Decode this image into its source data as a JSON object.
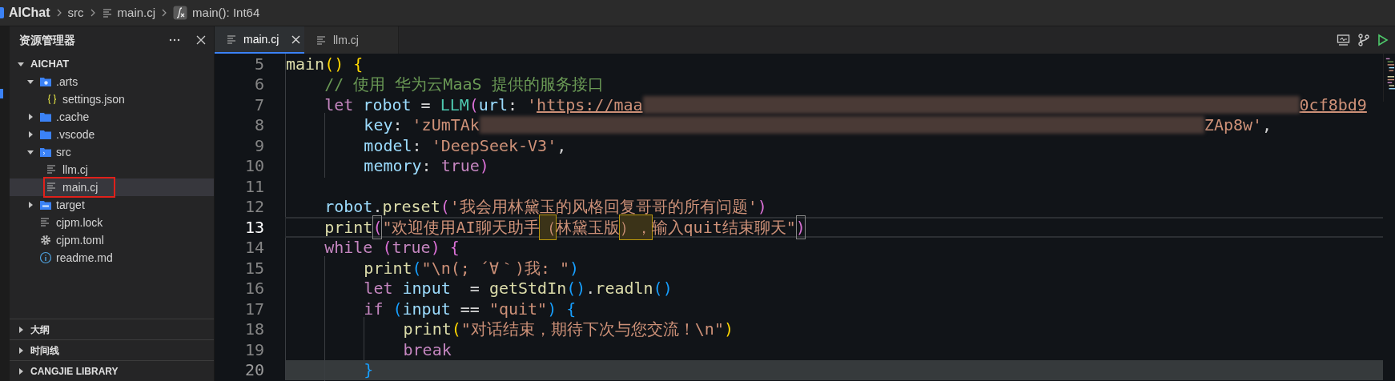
{
  "breadcrumb": [
    {
      "text": "AIChat",
      "kind": "folder"
    },
    {
      "text": "src",
      "kind": "folder"
    },
    {
      "text": "main.cj",
      "kind": "file"
    },
    {
      "text": "main(): Int64",
      "kind": "function"
    }
  ],
  "explorer": {
    "title": "资源管理器",
    "root": {
      "label": "AICHAT",
      "expanded": true,
      "children": [
        {
          "label": ".arts",
          "kind": "configfolder",
          "expanded": true,
          "selected": false,
          "children": [
            {
              "label": "settings.json",
              "kind": "json",
              "selected": false
            }
          ]
        },
        {
          "label": ".cache",
          "kind": "folder",
          "expanded": false,
          "selected": false
        },
        {
          "label": ".vscode",
          "kind": "folder",
          "expanded": false,
          "selected": false
        },
        {
          "label": "src",
          "kind": "sourcefolder",
          "expanded": true,
          "selected": false,
          "children": [
            {
              "label": "llm.cj",
              "kind": "text",
              "selected": false
            },
            {
              "label": "main.cj",
              "kind": "text",
              "selected": true,
              "annotated": true
            }
          ]
        },
        {
          "label": "target",
          "kind": "buildfolder",
          "expanded": false,
          "selected": false
        },
        {
          "label": "cjpm.lock",
          "kind": "text",
          "selected": false
        },
        {
          "label": "cjpm.toml",
          "kind": "config",
          "selected": false
        },
        {
          "label": "readme.md",
          "kind": "info",
          "selected": false
        }
      ]
    },
    "panels": [
      {
        "label": "大纲",
        "expanded": false
      },
      {
        "label": "时间线",
        "expanded": false
      },
      {
        "label": "CANGJIE LIBRARY",
        "expanded": false
      }
    ]
  },
  "tabs": [
    {
      "label": "main.cj",
      "selected": true
    },
    {
      "label": "llm.cj",
      "selected": false
    }
  ],
  "editor": {
    "lines": [
      {
        "number": "5",
        "current": false,
        "highlighted": false,
        "tokens": [
          {
            "text": "main",
            "kind": "fn"
          },
          {
            "text": "() {",
            "kind": "b1"
          }
        ]
      },
      {
        "number": "6",
        "current": false,
        "highlighted": false,
        "tokens": [
          {
            "text": "    // 使用 华为云MaaS 提供的服务接口",
            "kind": "cmt"
          }
        ]
      },
      {
        "number": "7",
        "current": false,
        "highlighted": false,
        "tokens": [
          {
            "text": "    let",
            "kind": "kw"
          },
          {
            "text": " robot",
            "kind": "var"
          },
          {
            "text": " = ",
            "kind": "plain"
          },
          {
            "text": "LLM",
            "kind": "type"
          },
          {
            "text": "(",
            "kind": "b2"
          },
          {
            "text": "url",
            "kind": "var"
          },
          {
            "text": ": ",
            "kind": "plain"
          },
          {
            "text": "'",
            "kind": "str"
          },
          {
            "text": "https://maa",
            "kind": "link"
          },
          {
            "kind": "redacted"
          },
          {
            "text": "0cf8bd9",
            "kind": "link"
          }
        ]
      },
      {
        "number": "8",
        "current": false,
        "highlighted": false,
        "tokens": [
          {
            "text": "        key",
            "kind": "var"
          },
          {
            "text": ": ",
            "kind": "plain"
          },
          {
            "text": "'zUmTAk",
            "kind": "str"
          },
          {
            "kind": "redacted"
          },
          {
            "text": "ZAp8w'",
            "kind": "str"
          },
          {
            "text": ",",
            "kind": "plain"
          }
        ]
      },
      {
        "number": "9",
        "current": false,
        "highlighted": false,
        "tokens": [
          {
            "text": "        model",
            "kind": "var"
          },
          {
            "text": ": ",
            "kind": "plain"
          },
          {
            "text": "'DeepSeek-V3'",
            "kind": "str"
          },
          {
            "text": ",",
            "kind": "plain"
          }
        ]
      },
      {
        "number": "10",
        "current": false,
        "highlighted": false,
        "tokens": [
          {
            "text": "        memory",
            "kind": "var"
          },
          {
            "text": ": ",
            "kind": "plain"
          },
          {
            "text": "true",
            "kind": "kw"
          },
          {
            "text": ")",
            "kind": "b2"
          }
        ]
      },
      {
        "number": "11",
        "current": false,
        "highlighted": false
      },
      {
        "number": "12",
        "current": false,
        "highlighted": false,
        "tokens": [
          {
            "text": "    robot",
            "kind": "var"
          },
          {
            "text": ".",
            "kind": "plain"
          },
          {
            "text": "preset",
            "kind": "fn"
          },
          {
            "text": "(",
            "kind": "b2"
          },
          {
            "text": "'我会用林黛玉的风格回复哥哥的所有问题'",
            "kind": "str"
          },
          {
            "text": ")",
            "kind": "b2"
          }
        ]
      },
      {
        "number": "13",
        "current": true,
        "highlighted": false,
        "tokens": [
          {
            "text": "    print",
            "kind": "fn"
          },
          {
            "text": "(",
            "kind": "match"
          },
          {
            "text": "\"欢迎使用AI聊天助手",
            "kind": "str"
          },
          {
            "text": "（",
            "kind": "flagged"
          },
          {
            "text": "林黛玉版",
            "kind": "str"
          },
          {
            "text": "），",
            "kind": "flagged"
          },
          {
            "text": "输入quit结束聊天\"",
            "kind": "str"
          },
          {
            "text": ")",
            "kind": "match"
          }
        ]
      },
      {
        "number": "14",
        "current": false,
        "highlighted": false,
        "tokens": [
          {
            "text": "    while ",
            "kind": "kw"
          },
          {
            "text": "(",
            "kind": "b2"
          },
          {
            "text": "true",
            "kind": "kw"
          },
          {
            "text": ") {",
            "kind": "b2"
          }
        ]
      },
      {
        "number": "15",
        "current": false,
        "highlighted": false,
        "tokens": [
          {
            "text": "        print",
            "kind": "fn"
          },
          {
            "text": "(",
            "kind": "b3"
          },
          {
            "text": "\"\\n(; ´∀｀)我: \"",
            "kind": "str"
          },
          {
            "text": ")",
            "kind": "b3"
          }
        ]
      },
      {
        "number": "16",
        "current": false,
        "highlighted": false,
        "tokens": [
          {
            "text": "        let",
            "kind": "kw"
          },
          {
            "text": " input",
            "kind": "var"
          },
          {
            "text": "  = ",
            "kind": "plain"
          },
          {
            "text": "getStdIn",
            "kind": "fn"
          },
          {
            "text": "()",
            "kind": "b3"
          },
          {
            "text": ".",
            "kind": "plain"
          },
          {
            "text": "readln",
            "kind": "fn"
          },
          {
            "text": "()",
            "kind": "b3"
          }
        ]
      },
      {
        "number": "17",
        "current": false,
        "highlighted": false,
        "tokens": [
          {
            "text": "        if ",
            "kind": "kw"
          },
          {
            "text": "(",
            "kind": "b3"
          },
          {
            "text": "input",
            "kind": "var"
          },
          {
            "text": " == ",
            "kind": "plain"
          },
          {
            "text": "\"quit\"",
            "kind": "str"
          },
          {
            "text": ") {",
            "kind": "b3"
          }
        ]
      },
      {
        "number": "18",
        "current": false,
        "highlighted": false,
        "tokens": [
          {
            "text": "            print",
            "kind": "fn"
          },
          {
            "text": "(",
            "kind": "b1"
          },
          {
            "text": "\"对话结束，期待下次与您交流！\\n\"",
            "kind": "str"
          },
          {
            "text": ")",
            "kind": "b1"
          }
        ]
      },
      {
        "number": "19",
        "current": false,
        "highlighted": false,
        "tokens": [
          {
            "text": "            break",
            "kind": "kw"
          }
        ]
      },
      {
        "number": "20",
        "current": false,
        "highlighted": true,
        "tokens": [
          {
            "text": "        }",
            "kind": "b3"
          }
        ]
      }
    ]
  }
}
